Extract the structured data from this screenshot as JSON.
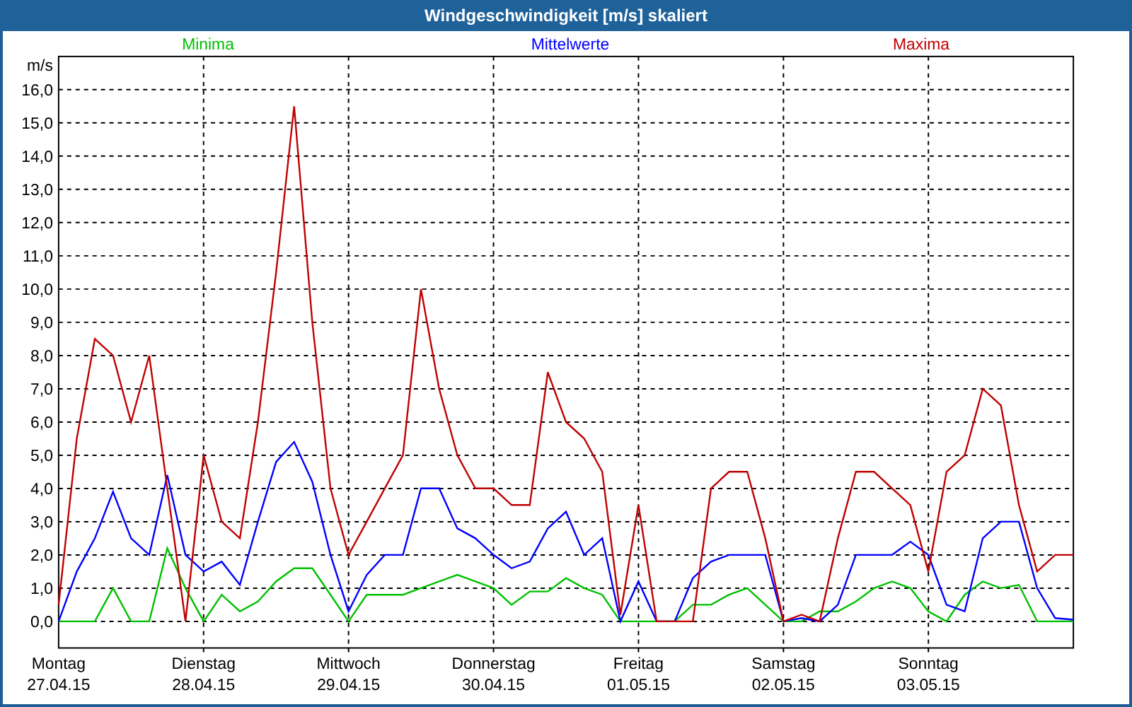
{
  "window": {
    "title": "Windgeschwindigkeit [m/s] skaliert"
  },
  "chart": {
    "chart_data": {
      "type": "line",
      "grid": true,
      "ylabel": "m/s",
      "categories": [
        "Montag\n27.04.15",
        null,
        null,
        null,
        null,
        null,
        null,
        null,
        "Dienstag\n28.04.15",
        null,
        null,
        null,
        null,
        null,
        null,
        null,
        "Mittwoch\n29.04.15",
        null,
        null,
        null,
        null,
        null,
        null,
        null,
        "Donnerstag\n30.04.15",
        null,
        null,
        null,
        null,
        null,
        null,
        null,
        "Freitag\n01.05.15",
        null,
        null,
        null,
        null,
        null,
        null,
        null,
        "Samstag\n02.05.15",
        null,
        null,
        null,
        null,
        null,
        null,
        null,
        "Sonntag\n03.05.15",
        null,
        null,
        null,
        null,
        null,
        null,
        null,
        null
      ],
      "ylim": [
        -0.8,
        17
      ],
      "yticks": [
        {
          "value": 0,
          "label": "0,0"
        },
        {
          "value": 1,
          "label": "1,0"
        },
        {
          "value": 2,
          "label": "2,0"
        },
        {
          "value": 3,
          "label": "3,0"
        },
        {
          "value": 4,
          "label": "4,0"
        },
        {
          "value": 5,
          "label": "5,0"
        },
        {
          "value": 6,
          "label": "6,0"
        },
        {
          "value": 7,
          "label": "7,0"
        },
        {
          "value": 8,
          "label": "8,0"
        },
        {
          "value": 9,
          "label": "9,0"
        },
        {
          "value": 10,
          "label": "10,0"
        },
        {
          "value": 11,
          "label": "11,0"
        },
        {
          "value": 12,
          "label": "12,0"
        },
        {
          "value": 13,
          "label": "13,0"
        },
        {
          "value": 14,
          "label": "14,0"
        },
        {
          "value": 15,
          "label": "15,0"
        },
        {
          "value": 16,
          "label": "16,0"
        }
      ],
      "series": [
        {
          "name": "Minima",
          "color": "#00c000",
          "values": [
            0,
            0,
            0,
            1.0,
            0,
            0,
            2.2,
            1.0,
            0,
            0.8,
            0.3,
            0.6,
            1.2,
            1.6,
            1.6,
            0.8,
            0,
            0.8,
            0.8,
            0.8,
            1.0,
            1.2,
            1.4,
            1.2,
            1.0,
            0.5,
            0.9,
            0.9,
            1.3,
            1.0,
            0.8,
            0,
            0,
            0,
            0,
            0.5,
            0.5,
            0.8,
            1.0,
            0.5,
            0,
            0,
            0.3,
            0.3,
            0.6,
            1.0,
            1.2,
            1.0,
            0.3,
            0,
            0.8,
            1.2,
            1.0,
            1.1,
            0,
            0,
            0
          ]
        },
        {
          "name": "Mittelwerte",
          "color": "#0000ff",
          "values": [
            0,
            1.5,
            2.5,
            3.9,
            2.5,
            2.0,
            4.4,
            2.0,
            1.5,
            1.8,
            1.1,
            3.0,
            4.8,
            5.4,
            4.2,
            2.0,
            0.3,
            1.4,
            2.0,
            2.0,
            4.0,
            4.0,
            2.8,
            2.5,
            2.0,
            1.6,
            1.8,
            2.8,
            3.3,
            2.0,
            2.5,
            0,
            1.2,
            0,
            0,
            1.3,
            1.8,
            2.0,
            2.0,
            2.0,
            0,
            0.1,
            0,
            0.5,
            2.0,
            2.0,
            2.0,
            2.4,
            2.0,
            0.5,
            0.3,
            2.5,
            3.0,
            3.0,
            1.0,
            0.1,
            0.05
          ]
        },
        {
          "name": "Maxima",
          "color": "#c00000",
          "values": [
            0.5,
            5.5,
            8.5,
            8.0,
            6.0,
            8.0,
            4.0,
            0,
            5.0,
            3.0,
            2.5,
            6.0,
            10.5,
            15.5,
            9.0,
            4.0,
            2.0,
            3.0,
            4.0,
            5.0,
            10.0,
            7.0,
            5.0,
            4.0,
            4.0,
            3.5,
            3.5,
            7.5,
            6.0,
            5.5,
            4.5,
            0.2,
            3.5,
            0,
            0,
            0,
            4.0,
            4.5,
            4.5,
            2.5,
            0,
            0.2,
            0,
            2.5,
            4.5,
            4.5,
            4.0,
            3.5,
            1.5,
            4.5,
            5.0,
            7.0,
            6.5,
            3.5,
            1.5,
            2.0,
            2.0
          ]
        }
      ]
    }
  }
}
